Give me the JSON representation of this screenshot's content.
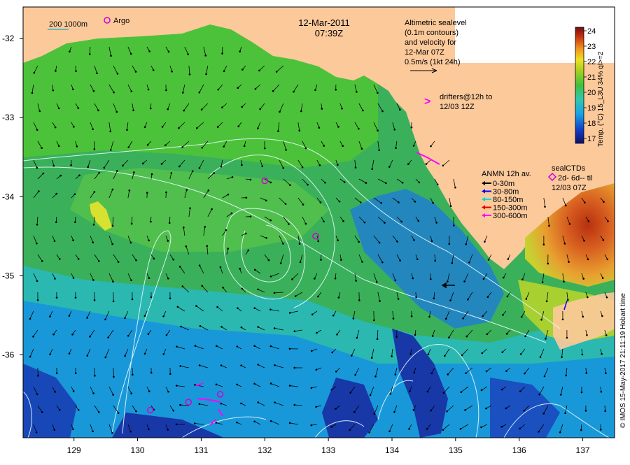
{
  "header": {
    "date": "12-Mar-2011",
    "time": "07:39Z"
  },
  "legend_topleft": {
    "isobath_label": "200  1000m",
    "argo_label": "Argo"
  },
  "altimetry_note": {
    "lines": [
      "Altimetric sealevel",
      "(0.1m contours)",
      "and velocity for",
      "12-Mar 07Z",
      "0.5m/s (1kt 24h)"
    ]
  },
  "drifters_note": {
    "symbol": ">",
    "lines": [
      "drifters@12h to",
      "12/03 12Z"
    ]
  },
  "anmn_legend": {
    "title": "ANMN 12h av.",
    "items": [
      {
        "label": "0-30m",
        "color": "#000000"
      },
      {
        "label": "30-80m",
        "color": "#0000ff"
      },
      {
        "label": "80-150m",
        "color": "#00d8d8"
      },
      {
        "label": "150-300m",
        "color": "#e00000"
      },
      {
        "label": "300-600m",
        "color": "#ff00ff"
      }
    ]
  },
  "sealctd_legend": {
    "title": "sealCTDs",
    "lines": [
      "2d- 6d-- til",
      "12/03 07Z"
    ]
  },
  "colorbar": {
    "label": "Temp. (°C) 15_L3U 34% ql>=2",
    "ticks": [
      "24",
      "23",
      "22",
      "21",
      "20",
      "19",
      "18",
      "17"
    ],
    "colors": {
      "land": "#fcc99b",
      "accent_magenta": "#ff00ff"
    }
  },
  "axes": {
    "x_ticks": [
      "129",
      "130",
      "131",
      "132",
      "133",
      "134",
      "135",
      "136",
      "137"
    ],
    "y_ticks": [
      "-32",
      "-33",
      "-34",
      "-35",
      "-36"
    ]
  },
  "credit": "© IMOS 15-May-2017 21:11:19 Hobart time",
  "argo_floats": [
    {
      "lon": 132.0,
      "lat": -33.8
    },
    {
      "lon": 132.8,
      "lat": -34.5
    },
    {
      "lon": 130.2,
      "lat": -36.7
    },
    {
      "lon": 130.8,
      "lat": -36.6
    },
    {
      "lon": 131.3,
      "lat": -36.5
    }
  ]
}
